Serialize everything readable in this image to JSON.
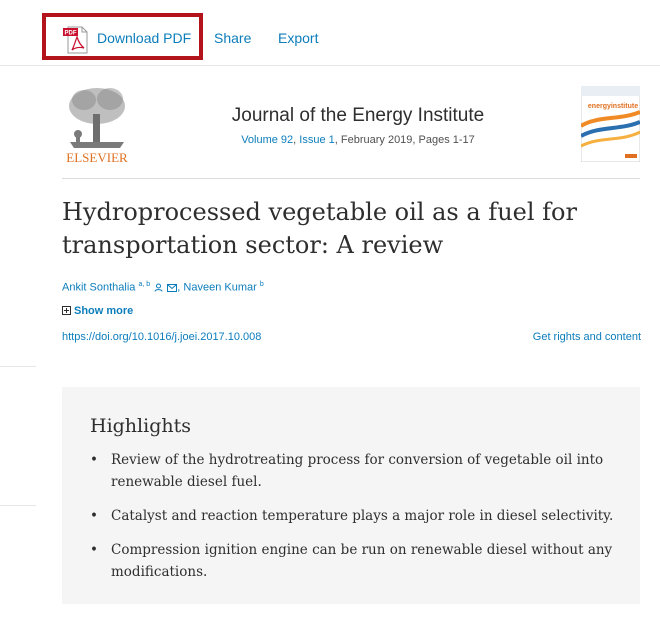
{
  "toolbar": {
    "download_label": "Download PDF",
    "share_label": "Share",
    "export_label": "Export",
    "pdf_icon_text": "PDF",
    "highlight_color": "#b3131b",
    "link_color": "#0c7dbb"
  },
  "journal": {
    "publisher_logo_text": "ELSEVIER",
    "title": "Journal of the Energy Institute",
    "volume": "Volume 92",
    "issue": "Issue 1",
    "date_pages": ", February 2019, Pages 1-17",
    "cover_text": "energyinstitute"
  },
  "article": {
    "title": "Hydroprocessed vegetable oil as a fuel for transportation sector: A review",
    "authors": [
      {
        "name": "Ankit Sonthalia",
        "sup": "a, b"
      },
      {
        "name": "Naveen Kumar",
        "sup": "b"
      }
    ],
    "show_more": "Show more",
    "doi": "https://doi.org/10.1016/j.joei.2017.10.008",
    "rights": "Get rights and content"
  },
  "highlights": {
    "heading": "Highlights",
    "items": [
      "Review of the hydrotreating process for conversion of vegetable oil into renewable diesel fuel.",
      "Catalyst and reaction temperature plays a major role in diesel selectivity.",
      "Compression ignition engine can be run on renewable diesel without any modifications."
    ]
  }
}
